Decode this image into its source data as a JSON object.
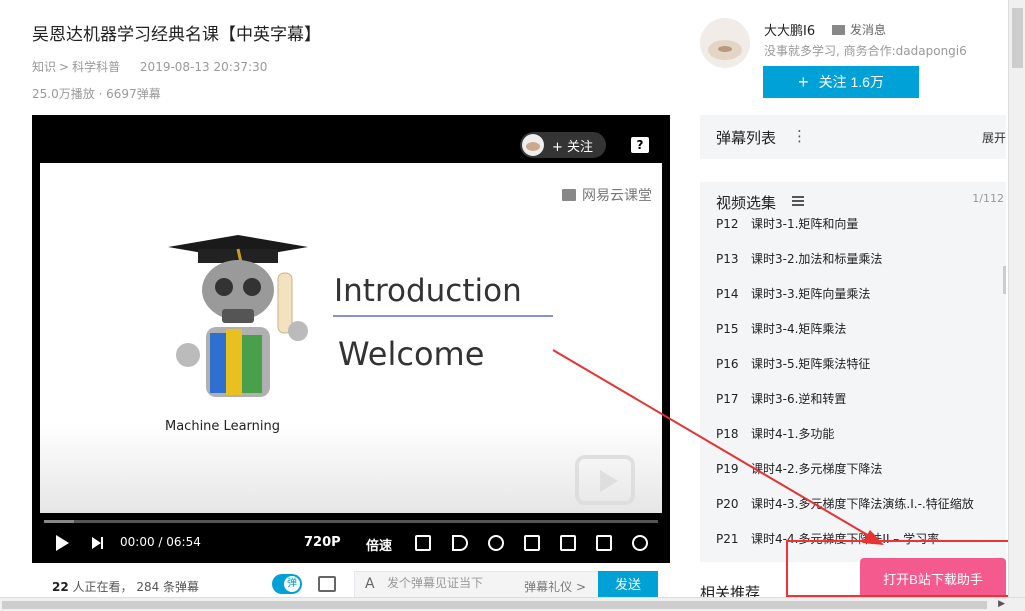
{
  "video": {
    "title": "吴恩达机器学习经典名课【中英字幕】",
    "category": "知识",
    "category_sep": ">",
    "subcategory": "科学科普",
    "date": "2019-08-13 20:37:30",
    "stats": "25.0万播放 · 6697弹幕"
  },
  "player": {
    "follow_label": "+ 关注",
    "help_label": "?",
    "slide": {
      "watermark": "网易云课堂",
      "heading": "Introduction",
      "subheading": "Welcome",
      "caption": "Machine Learning"
    },
    "controls": {
      "time": "00:00 / 06:54",
      "quality": "720P",
      "speed": "倍速"
    }
  },
  "below": {
    "watching_count": "22",
    "watching_text": " 人正在看， 284 条弹幕",
    "toggle_label": "弹",
    "input_placeholder": "发个弹幕见证当下",
    "etiquette": "弹幕礼仪 >",
    "send": "发送",
    "a_icon": "A"
  },
  "uploader": {
    "name": "大大鹏I6",
    "message": "发消息",
    "desc": "没事就多学习, 商务合作:dadapongi6",
    "follow": "关注 1.6万",
    "plus": "+"
  },
  "danmaku_list": {
    "label": "弹幕列表",
    "dots": "⋮",
    "expand": "展开"
  },
  "episodes": {
    "label": "视频选集",
    "count": "1/112",
    "items": [
      {
        "p": "P12",
        "t": "课时3-1.矩阵和向量"
      },
      {
        "p": "P13",
        "t": "课时3-2.加法和标量乘法"
      },
      {
        "p": "P14",
        "t": "课时3-3.矩阵向量乘法"
      },
      {
        "p": "P15",
        "t": "课时3-4.矩阵乘法"
      },
      {
        "p": "P16",
        "t": "课时3-5.矩阵乘法特征"
      },
      {
        "p": "P17",
        "t": "课时3-6.逆和转置"
      },
      {
        "p": "P18",
        "t": "课时4-1.多功能"
      },
      {
        "p": "P19",
        "t": "课时4-2.多元梯度下降法"
      },
      {
        "p": "P20",
        "t": "课时4-3.多元梯度下降法演练.I.-.特征缩放"
      },
      {
        "p": "P21",
        "t": "课时4-4.多元梯度下降法II – 学习率"
      }
    ]
  },
  "related": "相关推荐",
  "download_helper": "打开B站下载助手",
  "colors": {
    "accent": "#00a1d6",
    "pink": "#f45a8d",
    "annotation": "#e33333"
  }
}
